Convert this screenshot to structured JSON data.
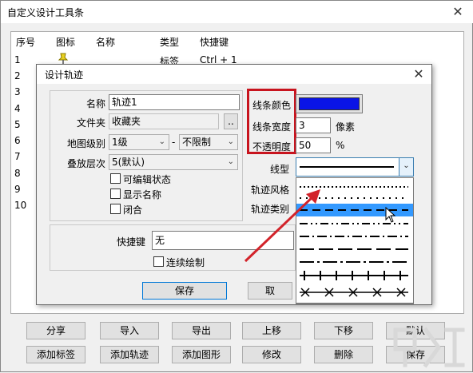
{
  "window": {
    "title": "自定义设计工具条",
    "close_icon": "✕"
  },
  "list": {
    "headers": [
      "序号",
      "图标",
      "名称",
      "类型",
      "快捷键"
    ],
    "row1": {
      "num": "1",
      "icon": "pin-icon",
      "type": "标签",
      "shortcut": "Ctrl + 1"
    },
    "row_numbers": [
      "2",
      "3",
      "4",
      "5",
      "6",
      "7",
      "8",
      "9",
      "10"
    ]
  },
  "bottom_buttons": {
    "row1": [
      "分享",
      "导入",
      "导出",
      "上移",
      "下移",
      "默认"
    ],
    "row2": [
      "添加标签",
      "添加轨迹",
      "添加图形",
      "修改",
      "删除",
      "保存"
    ]
  },
  "dialog": {
    "title": "设计轨迹",
    "close_icon": "✕",
    "name_label": "名称",
    "name_value": "轨迹1",
    "folder_label": "文件夹",
    "folder_value": "收藏夹",
    "folder_browse": "..",
    "level_label": "地图级别",
    "level_value": "1级",
    "level_dash": "-",
    "level_max": "不限制",
    "layer_label": "叠放层次",
    "layer_value": "5(默认)",
    "check_editable": "可编辑状态",
    "check_showname": "显示名称",
    "check_closed": "闭合",
    "line_color_label": "线条颜色",
    "line_color": "#0a14e6",
    "line_width_label": "线条宽度",
    "line_width_value": "3",
    "line_width_unit": "像素",
    "opacity_label": "不透明度",
    "opacity_value": "50",
    "opacity_unit": "%",
    "line_type_label": "线型",
    "track_style_label": "轨迹风格",
    "track_type_label": "轨迹类别",
    "shortcut_label": "快捷键",
    "shortcut_value": "无",
    "continuous_label": "连续绘制",
    "save_button": "保存",
    "cancel_button": "取"
  },
  "colors": {
    "highlight_red": "#c8141e",
    "arrow_red": "#d2232a",
    "selection_blue": "#3399ff"
  }
}
